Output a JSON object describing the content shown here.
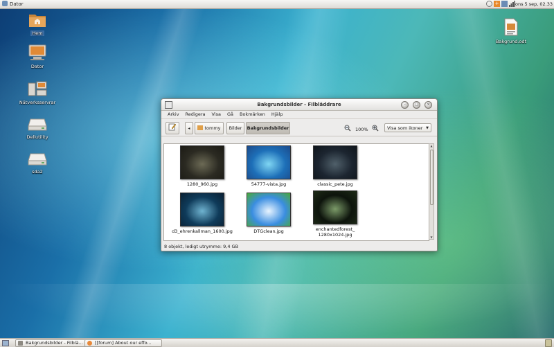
{
  "top_panel": {
    "app_menu": "Dator",
    "clock": "ons  5 sep, 02.33"
  },
  "desktop_icons": [
    {
      "label": "Hem",
      "icon": "home-folder-icon"
    },
    {
      "label": "Dator",
      "icon": "computer-icon"
    },
    {
      "label": "Nätverksservrar",
      "icon": "network-servers-icon"
    },
    {
      "label": "Dellutility",
      "icon": "drive-icon"
    },
    {
      "label": "sda2",
      "icon": "drive-icon"
    },
    {
      "label": "Bakgrund.odt",
      "icon": "document-icon"
    }
  ],
  "window": {
    "title": "Bakgrundsbilder - Filbläddrare",
    "menu": [
      "Arkiv",
      "Redigera",
      "Visa",
      "Gå",
      "Bokmärken",
      "Hjälp"
    ],
    "path": [
      "tommy",
      "Bilder",
      "Bakgrundsbilder"
    ],
    "zoom": "100%",
    "view_mode": "Visa som ikoner",
    "files": [
      {
        "name": "1280_960.jpg",
        "colors": [
          "#2b2a22",
          "#6c6a55",
          "#1b1a14"
        ]
      },
      {
        "name": "54777-vista.jpg",
        "colors": [
          "#1d6fb8",
          "#7fd6f3",
          "#1c4a8a"
        ]
      },
      {
        "name": "classic_pete.jpg",
        "colors": [
          "#1c2530",
          "#50606a",
          "#0f151b"
        ]
      },
      {
        "name": "d3_ehrenkallman_1600.jpg",
        "colors": [
          "#0f3b5a",
          "#6fb3d0",
          "#0a2033"
        ]
      },
      {
        "name": "DTGclean.jpg",
        "colors": [
          "#3a8de0",
          "#e8f4ff",
          "#4aa93a"
        ]
      },
      {
        "name": "enchantedforest_\n1280x1024.jpg",
        "colors": [
          "#0d140c",
          "#7b9a68",
          "#1d2a16"
        ]
      }
    ],
    "status": "8 objekt, ledigt utrymme: 9,4 GB"
  },
  "taskbar": [
    {
      "label": "Bakgrundsbilder - Filblä...",
      "icon": "file-browser-icon"
    },
    {
      "label": "[[forum] About our effo...",
      "icon": "firefox-icon"
    }
  ]
}
